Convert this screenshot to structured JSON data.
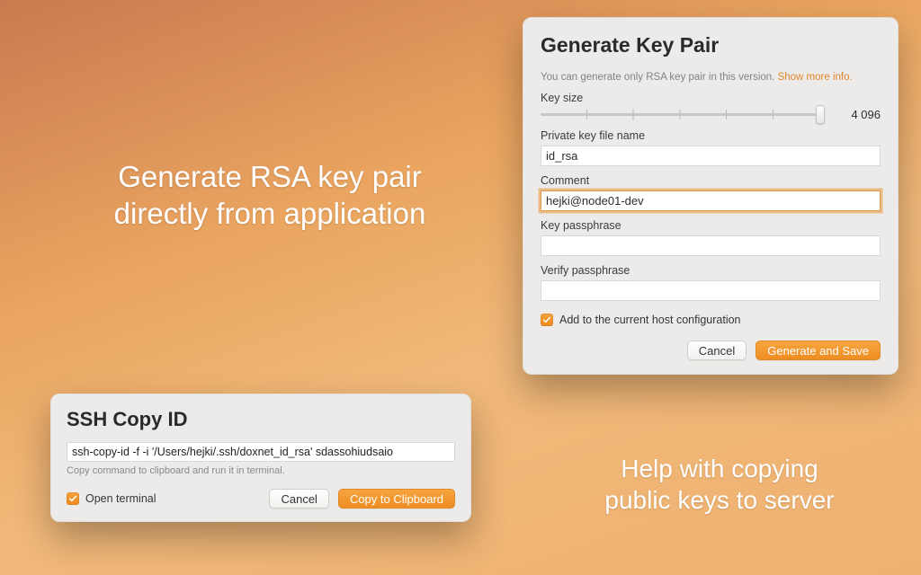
{
  "headline1": "Generate RSA key pair\ndirectly from application",
  "headline2": "Help with copying\npublic keys to server",
  "genPanel": {
    "title": "Generate Key Pair",
    "subtext": "You can generate only RSA key pair in this version. ",
    "moreInfo": "Show more info.",
    "keySizeLabel": "Key size",
    "keySizeValue": "4 096",
    "privateKeyLabel": "Private key file name",
    "privateKeyValue": "id_rsa",
    "commentLabel": "Comment",
    "commentValue": "hejki@node01-dev",
    "passLabel": "Key passphrase",
    "passValue": "",
    "verifyLabel": "Verify passphrase",
    "verifyValue": "",
    "addHostLabel": "Add to the current host configuration",
    "cancel": "Cancel",
    "generate": "Generate and Save"
  },
  "sshPanel": {
    "title": "SSH Copy ID",
    "command": "ssh-copy-id -f -i '/Users/hejki/.ssh/doxnet_id_rsa' sdassohiudsaio",
    "help": "Copy command to clipboard and run it in terminal.",
    "openTerminal": "Open terminal",
    "cancel": "Cancel",
    "copy": "Copy to Clipboard"
  }
}
